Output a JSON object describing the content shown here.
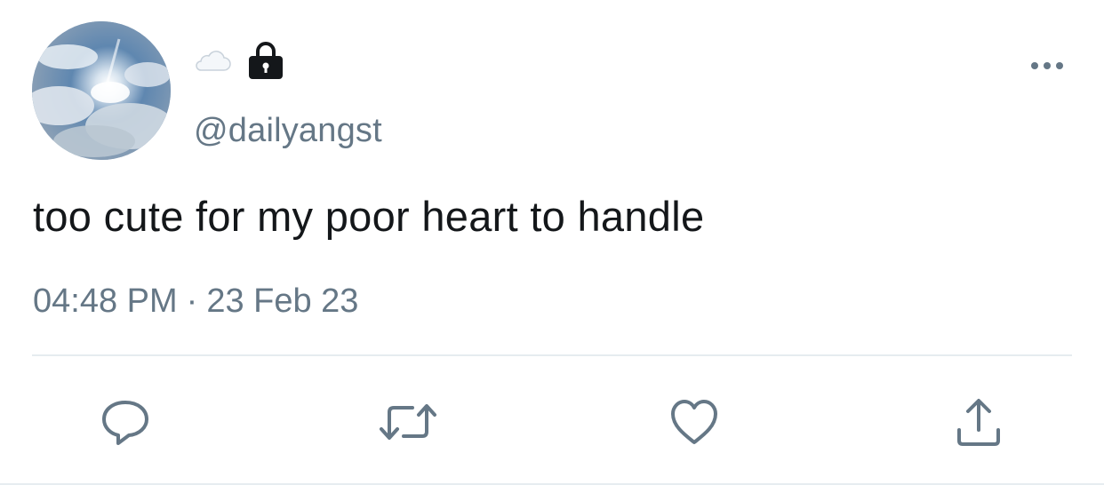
{
  "tweet": {
    "display_name_icons": [
      "cloud-icon",
      "lock-icon"
    ],
    "handle": "@dailyangst",
    "text": "too cute for my poor heart to handle",
    "time": "04:48 PM",
    "separator": "·",
    "date": "23 Feb 23"
  },
  "actions": [
    "reply-icon",
    "retweet-icon",
    "like-icon",
    "share-icon"
  ],
  "colors": {
    "text": "#14171a",
    "secondary": "#657786",
    "divider": "#e6ecf0",
    "icon": "#657786"
  }
}
